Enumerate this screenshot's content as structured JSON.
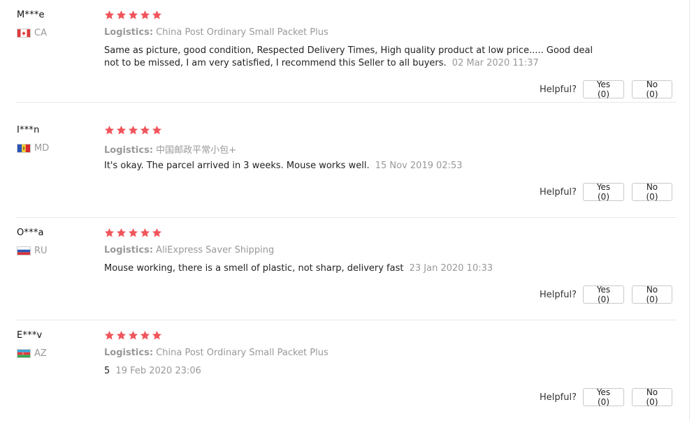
{
  "colors": {
    "star": "#f0555b",
    "muted_text": "#999999",
    "divider": "#e8e8e8",
    "button_border": "#c9c9c9"
  },
  "labels": {
    "logistics": "Logistics:",
    "helpful": "Helpful?"
  },
  "reviews": [
    {
      "user": "M***e",
      "country": "CA",
      "flag": "canada-flag-icon",
      "rating": 5,
      "logistics": "China Post Ordinary Small Packet Plus",
      "text": "Same as picture, good condition, Respected Delivery Times, High quality product at low price..... Good deal not to be missed, I am very satisfied, I recommend this Seller to all buyers.",
      "time": "02 Mar 2020 11:37",
      "yes": "Yes (0)",
      "no": "No (0)"
    },
    {
      "user": "I***n",
      "country": "MD",
      "flag": "moldova-flag-icon",
      "rating": 5,
      "logistics": "中国邮政平常小包+",
      "text": "It's okay. The parcel arrived in 3 weeks. Mouse works well.",
      "time": "15 Nov 2019 02:53",
      "yes": "Yes (0)",
      "no": "No (0)"
    },
    {
      "user": "O***a",
      "country": "RU",
      "flag": "russia-flag-icon",
      "rating": 5,
      "logistics": "AliExpress Saver Shipping",
      "text": "Mouse working, there is a smell of plastic, not sharp, delivery fast",
      "time": "23 Jan 2020 10:33",
      "yes": "Yes (0)",
      "no": "No (0)"
    },
    {
      "user": "E***v",
      "country": "AZ",
      "flag": "azerbaijan-flag-icon",
      "rating": 5,
      "logistics": "China Post Ordinary Small Packet Plus",
      "text": "5",
      "time": "19 Feb 2020 23:06",
      "yes": "Yes (0)",
      "no": "No (0)"
    }
  ]
}
